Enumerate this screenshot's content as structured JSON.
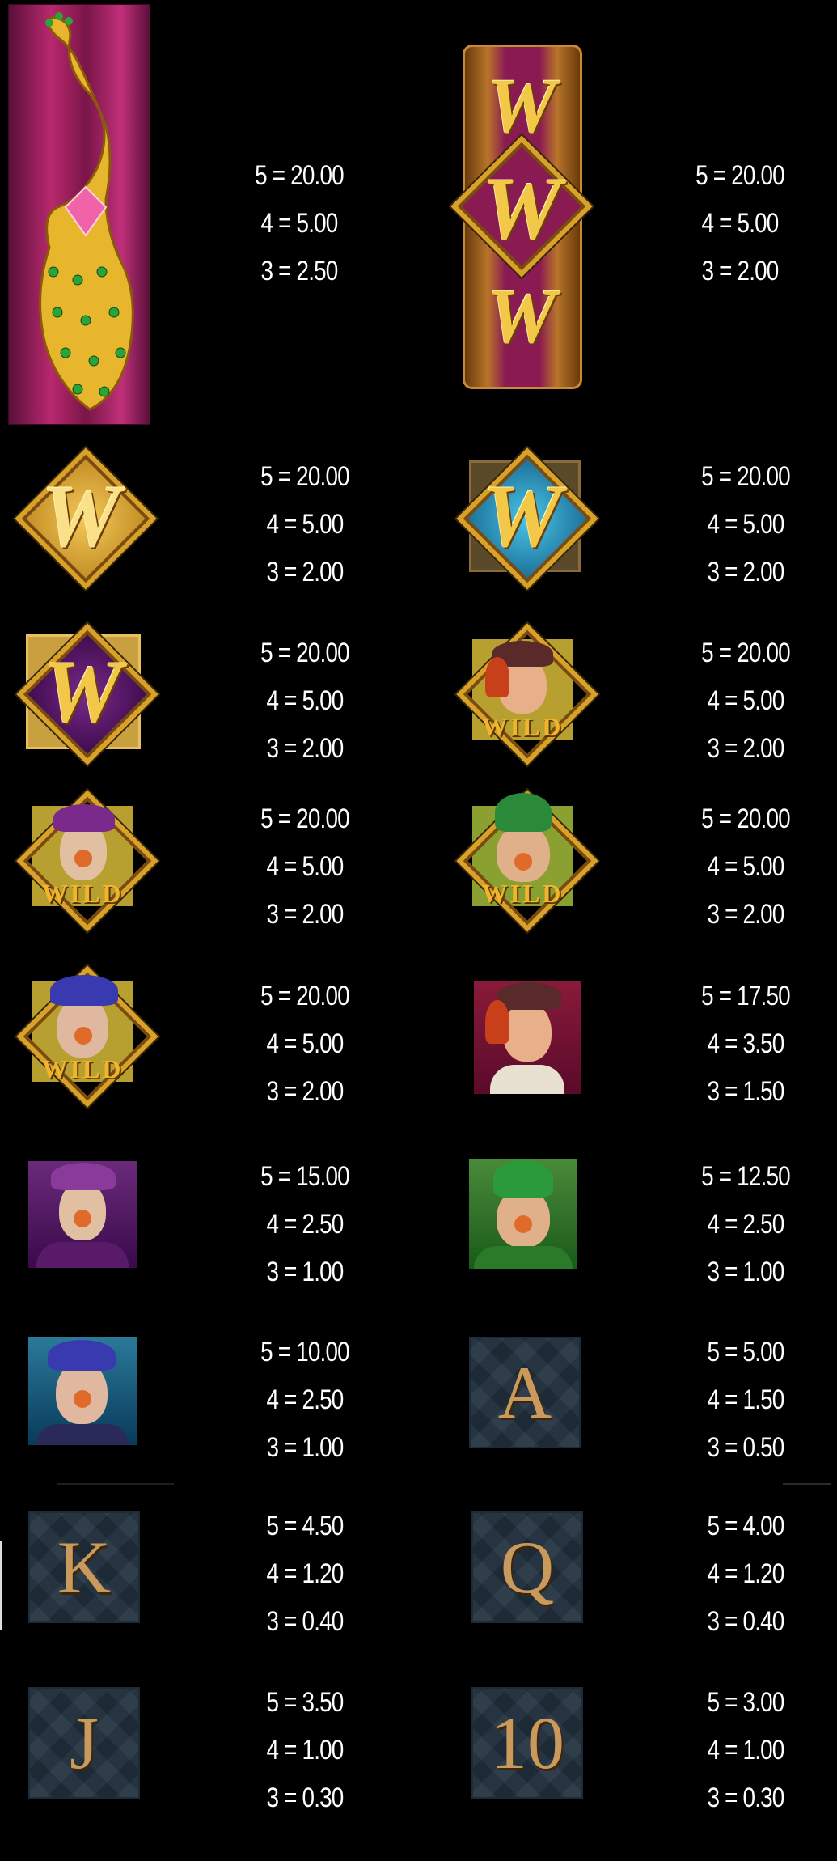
{
  "symbols": [
    {
      "id": "peacock",
      "pays": [
        "5 = 20.00",
        "4 = 5.00",
        "3 = 2.50"
      ]
    },
    {
      "id": "stacked-wild",
      "letter": "W",
      "pays": [
        "5 = 20.00",
        "4 = 5.00",
        "3 = 2.00"
      ]
    },
    {
      "id": "gold-wild",
      "letter": "W",
      "pays": [
        "5 = 20.00",
        "4 = 5.00",
        "3 = 2.00"
      ]
    },
    {
      "id": "blue-wild",
      "letter": "W",
      "pays": [
        "5 = 20.00",
        "4 = 5.00",
        "3 = 2.00"
      ]
    },
    {
      "id": "purple-wild",
      "letter": "W",
      "pays": [
        "5 = 20.00",
        "4 = 5.00",
        "3 = 2.00"
      ]
    },
    {
      "id": "woman-wild",
      "label": "WILD",
      "pays": [
        "5 = 20.00",
        "4 = 5.00",
        "3 = 2.00"
      ]
    },
    {
      "id": "purple-man-wild",
      "label": "WILD",
      "pays": [
        "5 = 20.00",
        "4 = 5.00",
        "3 = 2.00"
      ]
    },
    {
      "id": "green-man-wild",
      "label": "WILD",
      "pays": [
        "5 = 20.00",
        "4 = 5.00",
        "3 = 2.00"
      ]
    },
    {
      "id": "blue-man-wild",
      "label": "WILD",
      "pays": [
        "5 = 20.00",
        "4 = 5.00",
        "3 = 2.00"
      ]
    },
    {
      "id": "woman",
      "pays": [
        "5 = 17.50",
        "4 = 3.50",
        "3 = 1.50"
      ]
    },
    {
      "id": "purple-man",
      "pays": [
        "5 = 15.00",
        "4 = 2.50",
        "3 = 1.00"
      ]
    },
    {
      "id": "green-man",
      "pays": [
        "5 = 12.50",
        "4 = 2.50",
        "3 = 1.00"
      ]
    },
    {
      "id": "blue-man",
      "pays": [
        "5 = 10.00",
        "4 = 2.50",
        "3 = 1.00"
      ]
    },
    {
      "id": "ace",
      "letter": "A",
      "pays": [
        "5 = 5.00",
        "4 = 1.50",
        "3 = 0.50"
      ]
    },
    {
      "id": "king",
      "letter": "K",
      "pays": [
        "5 = 4.50",
        "4 = 1.20",
        "3 = 0.40"
      ]
    },
    {
      "id": "queen",
      "letter": "Q",
      "pays": [
        "5 = 4.00",
        "4 = 1.20",
        "3 = 0.40"
      ]
    },
    {
      "id": "jack",
      "letter": "J",
      "pays": [
        "5 = 3.50",
        "4 = 1.00",
        "3 = 0.30"
      ]
    },
    {
      "id": "ten",
      "letter": "10",
      "pays": [
        "5 = 3.00",
        "4 = 1.00",
        "3 = 0.30"
      ]
    }
  ]
}
